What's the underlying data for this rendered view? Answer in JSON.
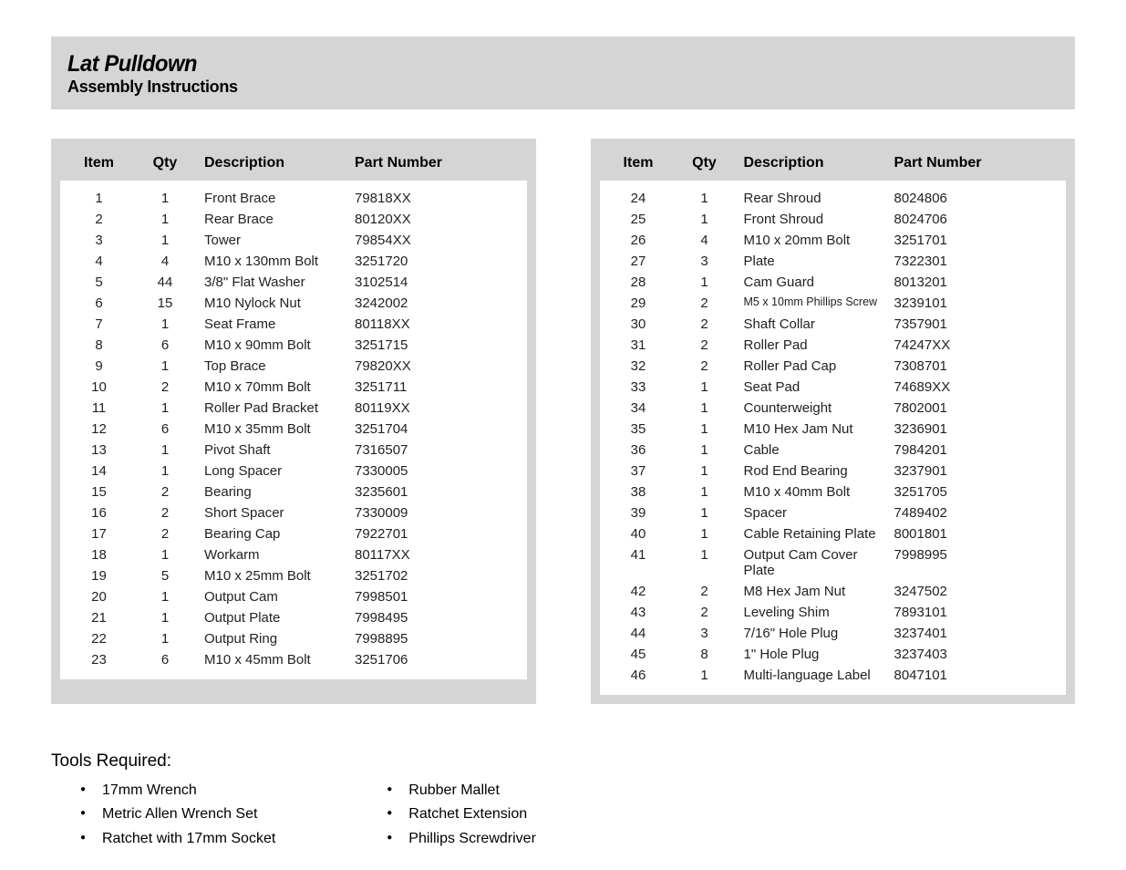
{
  "header": {
    "title": "Lat Pulldown",
    "subtitle": "Assembly Instructions"
  },
  "columns": {
    "item": "Item",
    "qty": "Qty",
    "description": "Description",
    "part_number": "Part Number"
  },
  "table1": [
    {
      "item": "1",
      "qty": "1",
      "desc": "Front Brace",
      "part": "79818XX"
    },
    {
      "item": "2",
      "qty": "1",
      "desc": "Rear Brace",
      "part": "80120XX"
    },
    {
      "item": "3",
      "qty": "1",
      "desc": "Tower",
      "part": "79854XX"
    },
    {
      "item": "4",
      "qty": "4",
      "desc": "M10 x 130mm Bolt",
      "part": "3251720"
    },
    {
      "item": "5",
      "qty": "44",
      "desc": "3/8\" Flat Washer",
      "part": "3102514"
    },
    {
      "item": "6",
      "qty": "15",
      "desc": "M10 Nylock Nut",
      "part": "3242002"
    },
    {
      "item": "7",
      "qty": "1",
      "desc": "Seat Frame",
      "part": "80118XX"
    },
    {
      "item": "8",
      "qty": "6",
      "desc": "M10 x 90mm Bolt",
      "part": "3251715"
    },
    {
      "item": "9",
      "qty": "1",
      "desc": "Top Brace",
      "part": "79820XX"
    },
    {
      "item": "10",
      "qty": "2",
      "desc": "M10 x 70mm Bolt",
      "part": "3251711"
    },
    {
      "item": "11",
      "qty": "1",
      "desc": "Roller Pad Bracket",
      "part": "80119XX"
    },
    {
      "item": "12",
      "qty": "6",
      "desc": "M10 x 35mm Bolt",
      "part": "3251704"
    },
    {
      "item": "13",
      "qty": "1",
      "desc": "Pivot Shaft",
      "part": "7316507"
    },
    {
      "item": "14",
      "qty": "1",
      "desc": "Long Spacer",
      "part": "7330005"
    },
    {
      "item": "15",
      "qty": "2",
      "desc": "Bearing",
      "part": "3235601"
    },
    {
      "item": "16",
      "qty": "2",
      "desc": "Short Spacer",
      "part": "7330009"
    },
    {
      "item": "17",
      "qty": "2",
      "desc": "Bearing Cap",
      "part": "7922701"
    },
    {
      "item": "18",
      "qty": "1",
      "desc": "Workarm",
      "part": "80117XX"
    },
    {
      "item": "19",
      "qty": "5",
      "desc": "M10 x 25mm Bolt",
      "part": "3251702"
    },
    {
      "item": "20",
      "qty": "1",
      "desc": "Output Cam",
      "part": "7998501"
    },
    {
      "item": "21",
      "qty": "1",
      "desc": "Output Plate",
      "part": "7998495"
    },
    {
      "item": "22",
      "qty": "1",
      "desc": "Output Ring",
      "part": "7998895"
    },
    {
      "item": "23",
      "qty": "6",
      "desc": "M10 x 45mm Bolt",
      "part": "3251706"
    }
  ],
  "table2": [
    {
      "item": "24",
      "qty": "1",
      "desc": "Rear Shroud",
      "part": "8024806"
    },
    {
      "item": "25",
      "qty": "1",
      "desc": "Front Shroud",
      "part": "8024706"
    },
    {
      "item": "26",
      "qty": "4",
      "desc": "M10 x 20mm Bolt",
      "part": "3251701"
    },
    {
      "item": "27",
      "qty": "3",
      "desc": "Plate",
      "part": "7322301"
    },
    {
      "item": "28",
      "qty": "1",
      "desc": "Cam Guard",
      "part": "8013201"
    },
    {
      "item": "29",
      "qty": "2",
      "desc": "M5 x 10mm Phillips Screw",
      "part": "3239101",
      "small": true
    },
    {
      "item": "30",
      "qty": "2",
      "desc": "Shaft Collar",
      "part": "7357901"
    },
    {
      "item": "31",
      "qty": "2",
      "desc": "Roller Pad",
      "part": "74247XX"
    },
    {
      "item": "32",
      "qty": "2",
      "desc": "Roller Pad Cap",
      "part": "7308701"
    },
    {
      "item": "33",
      "qty": "1",
      "desc": "Seat Pad",
      "part": "74689XX"
    },
    {
      "item": "34",
      "qty": "1",
      "desc": "Counterweight",
      "part": "7802001"
    },
    {
      "item": "35",
      "qty": "1",
      "desc": "M10 Hex Jam Nut",
      "part": "3236901"
    },
    {
      "item": "36",
      "qty": "1",
      "desc": "Cable",
      "part": "7984201"
    },
    {
      "item": "37",
      "qty": "1",
      "desc": "Rod End Bearing",
      "part": "3237901"
    },
    {
      "item": "38",
      "qty": "1",
      "desc": "M10 x 40mm Bolt",
      "part": "3251705"
    },
    {
      "item": "39",
      "qty": "1",
      "desc": "Spacer",
      "part": "7489402"
    },
    {
      "item": "40",
      "qty": "1",
      "desc": "Cable Retaining Plate",
      "part": "8001801"
    },
    {
      "item": "41",
      "qty": "1",
      "desc": "Output Cam Cover Plate",
      "part": "7998995"
    },
    {
      "item": "42",
      "qty": "2",
      "desc": "M8 Hex Jam Nut",
      "part": "3247502"
    },
    {
      "item": "43",
      "qty": "2",
      "desc": "Leveling Shim",
      "part": "7893101"
    },
    {
      "item": "44",
      "qty": "3",
      "desc": "7/16\" Hole Plug",
      "part": "3237401"
    },
    {
      "item": "45",
      "qty": "8",
      "desc": "1\" Hole Plug",
      "part": "3237403"
    },
    {
      "item": "46",
      "qty": "1",
      "desc": "Multi-language Label",
      "part": "8047101"
    }
  ],
  "tools": {
    "title": "Tools Required:",
    "col1": [
      "17mm Wrench",
      "Metric Allen Wrench Set",
      "Ratchet with 17mm Socket"
    ],
    "col2": [
      "Rubber Mallet",
      "Ratchet Extension",
      "Phillips Screwdriver"
    ]
  }
}
